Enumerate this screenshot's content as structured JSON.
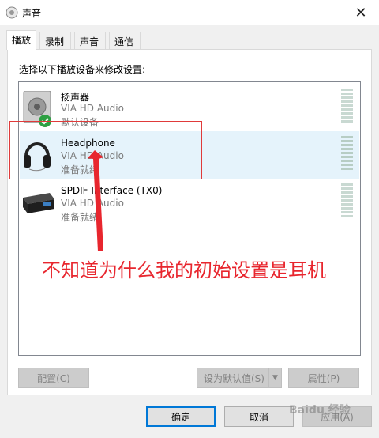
{
  "window": {
    "title": "声音",
    "close_icon": "close-icon"
  },
  "tabs": [
    {
      "label": "播放",
      "active": true
    },
    {
      "label": "录制",
      "active": false
    },
    {
      "label": "声音",
      "active": false
    },
    {
      "label": "通信",
      "active": false
    }
  ],
  "instruction": "选择以下播放设备来修改设置:",
  "devices": [
    {
      "name": "扬声器",
      "driver": "VIA HD Audio",
      "status": "默认设备",
      "icon": "speaker-icon",
      "default": true,
      "selected": false
    },
    {
      "name": "Headphone",
      "driver": "VIA HD Audio",
      "status": "准备就绪",
      "icon": "headphone-icon",
      "default": false,
      "selected": true
    },
    {
      "name": "SPDIF Interface (TX0)",
      "driver": "VIA HD Audio",
      "status": "准备就绪",
      "icon": "spdif-device-icon",
      "default": false,
      "selected": false
    }
  ],
  "buttons": {
    "configure": "配置(C)",
    "set_default": "设为默认值(S)",
    "properties": "属性(P)",
    "ok": "确定",
    "cancel": "取消",
    "apply": "应用(A)"
  },
  "annotation": {
    "text": "不知道为什么我的初始设置是耳机",
    "color": "#e8262e"
  },
  "watermark": "Baidu 经验"
}
